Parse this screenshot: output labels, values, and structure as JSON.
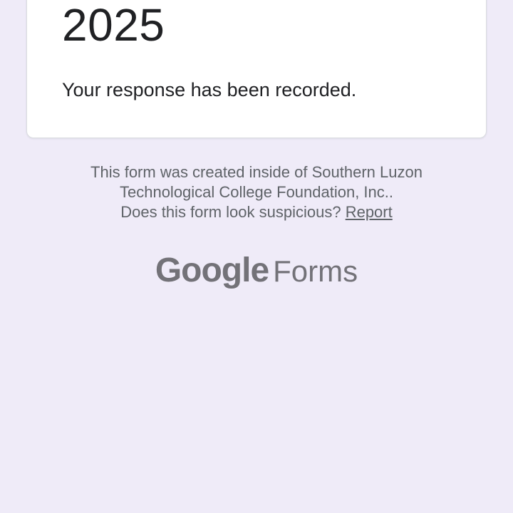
{
  "card": {
    "title": "2025",
    "message": "Your response has been recorded."
  },
  "footer": {
    "created_line1": "This form was created inside of Southern Luzon",
    "created_line2": "Technological College Foundation, Inc..",
    "suspicious_text": "Does this form look suspicious? ",
    "report_label": "Report"
  },
  "brand": {
    "google": "Google",
    "forms": "Forms"
  },
  "colors": {
    "page_background": "#efebf8",
    "card_background": "#ffffff",
    "text_primary": "#202124",
    "text_secondary": "#5f6368",
    "logo_gray": "#737278"
  }
}
